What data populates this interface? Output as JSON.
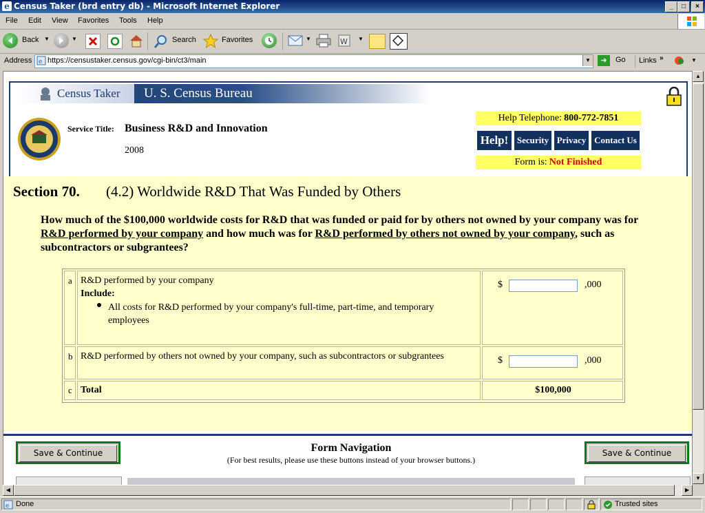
{
  "window": {
    "title": "Census Taker (brd entry db) - Microsoft Internet Explorer",
    "controls": {
      "minimize": "_",
      "maximize": "□",
      "close": "×"
    }
  },
  "menubar": {
    "items": [
      {
        "label": "File"
      },
      {
        "label": "Edit"
      },
      {
        "label": "View"
      },
      {
        "label": "Favorites"
      },
      {
        "label": "Tools"
      },
      {
        "label": "Help"
      }
    ]
  },
  "toolbar": {
    "back": "Back",
    "search": "Search",
    "favorites": "Favorites"
  },
  "addressbar": {
    "label": "Address",
    "url": "https://censustaker.census.gov/cgi-bin/ct3/main",
    "go": "Go",
    "links": "Links"
  },
  "page": {
    "banner_left": "Census Taker",
    "banner_right": "U. S. Census Bureau",
    "service_title_label": "Service Title:",
    "service_title": "Business R&D and Innovation",
    "year": "2008",
    "help_tel_label": "Help Telephone:",
    "help_tel": "800-772-7851",
    "nav": {
      "help": "Help!",
      "security": "Security",
      "privacy": "Privacy",
      "contact": "Contact Us"
    },
    "form_is_label": "Form is:",
    "form_status": "Not Finished",
    "section_title": "Section 70.",
    "section_subtitle": "(4.2) Worldwide R&D That Was Funded by Others",
    "question": {
      "part1": "How much of the $100,000 worldwide costs for R&D that was funded or paid for by others not owned by your company was for ",
      "link1": "R&D performed by your company",
      "part2": " and how much was for ",
      "link2": "R&D performed by others not owned by your company",
      "part3": ", such as subcontractors or subgrantees?"
    },
    "rows": {
      "a": {
        "letter": "a",
        "text": "R&D performed by your company",
        "include": "Include:",
        "bullet": "All costs for R&D performed by your company's full-time, part-time, and temporary employees",
        "currency": "$",
        "suffix": ",000",
        "value": ""
      },
      "b": {
        "letter": "b",
        "text": "R&D performed by others not owned by your company, such as subcontractors or subgrantees",
        "currency": "$",
        "suffix": ",000",
        "value": ""
      },
      "c": {
        "letter": "c",
        "text": "Total",
        "total": "$100,000"
      }
    },
    "form_nav_title": "Form Navigation",
    "form_nav_note": "(For best results, please use these buttons instead of your browser buttons.)",
    "save_continue": "Save & Continue"
  },
  "status": {
    "text": "Done",
    "zone": "Trusted sites"
  },
  "colors": {
    "titlebar": "#0a246a",
    "banner": "#1a3a6c",
    "yellow": "#ffffcc",
    "alert_red": "#cc0000",
    "button_border": "#0a7a18"
  }
}
